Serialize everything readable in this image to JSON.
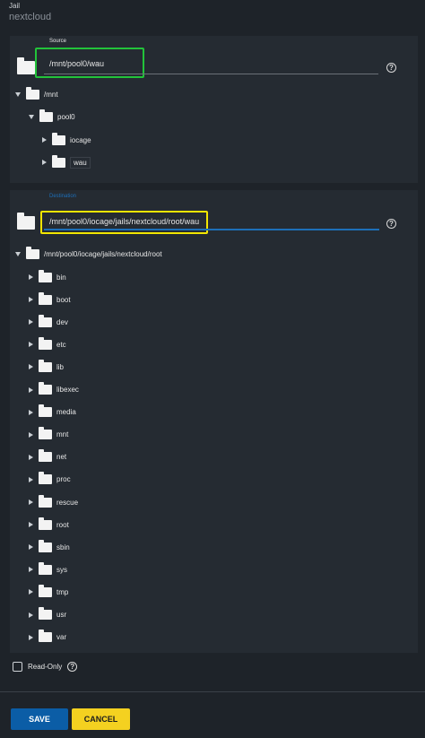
{
  "header": {
    "jail_label": "Jail",
    "jail_value": "nextcloud"
  },
  "source": {
    "label": "Source",
    "value": "/mnt/pool0/wau",
    "help_icon": "help-circle-icon",
    "tree": [
      {
        "label": "/mnt",
        "expanded": true
      },
      {
        "label": "pool0",
        "expanded": true
      },
      {
        "label": "iocage",
        "expanded": false
      },
      {
        "label": "wau",
        "expanded": false,
        "selected": true
      }
    ]
  },
  "destination": {
    "label": "Destination",
    "value": "/mnt/pool0/iocage/jails/nextcloud/root/wau",
    "help_icon": "help-circle-icon",
    "root": "/mnt/pool0/iocage/jails/nextcloud/root",
    "children": [
      "bin",
      "boot",
      "dev",
      "etc",
      "lib",
      "libexec",
      "media",
      "mnt",
      "net",
      "proc",
      "rescue",
      "root",
      "sbin",
      "sys",
      "tmp",
      "usr",
      "var"
    ]
  },
  "readonly": {
    "label": "Read-Only",
    "checked": false
  },
  "actions": {
    "save": "SAVE",
    "cancel": "CANCEL"
  },
  "colors": {
    "background": "#1e2329",
    "panel": "#252b32",
    "save": "#0b5da6",
    "cancel": "#f4d120",
    "highlight_source": "#22c33a",
    "highlight_destination": "#f2e500",
    "focus_underline": "#1d6fb8"
  }
}
